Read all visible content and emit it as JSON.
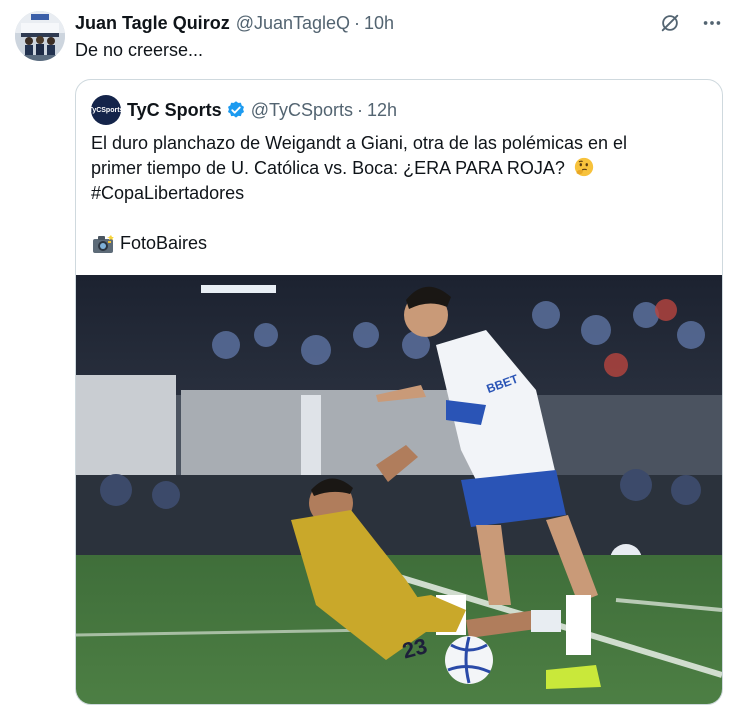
{
  "tweet": {
    "author_name": "Juan Tagle Quiroz",
    "author_handle": "@JuanTagleQ",
    "separator": "·",
    "time": "10h",
    "text": "De no creerse..."
  },
  "icons": {
    "grok": "grok-slash-icon",
    "more": "more-horizontal-icon",
    "verified": "verified-badge-icon",
    "camera": "camera-emoji-icon",
    "thinking": "thinking-face-emoji-icon"
  },
  "quote": {
    "author_name": "TyC Sports",
    "author_handle": "@TyCSports",
    "separator": "·",
    "time": "12h",
    "avatar_text": "TyCSports",
    "text_line1": "El duro planchazo de Weigandt a Giani, otra de las polémicas en el",
    "text_line2": "primer tiempo de U. Católica vs. Boca: ¿ERA PARA ROJA?",
    "hashtag": "#CopaLibertadores",
    "photo_credit": "FotoBaires"
  },
  "photo": {
    "jersey_number": "23",
    "sponsor_text": "BBET"
  },
  "colors": {
    "text": "#0f1419",
    "secondary": "#536471",
    "border": "#cfd9de",
    "verified": "#1d9bf0",
    "tyc_navy": "#14244a"
  }
}
